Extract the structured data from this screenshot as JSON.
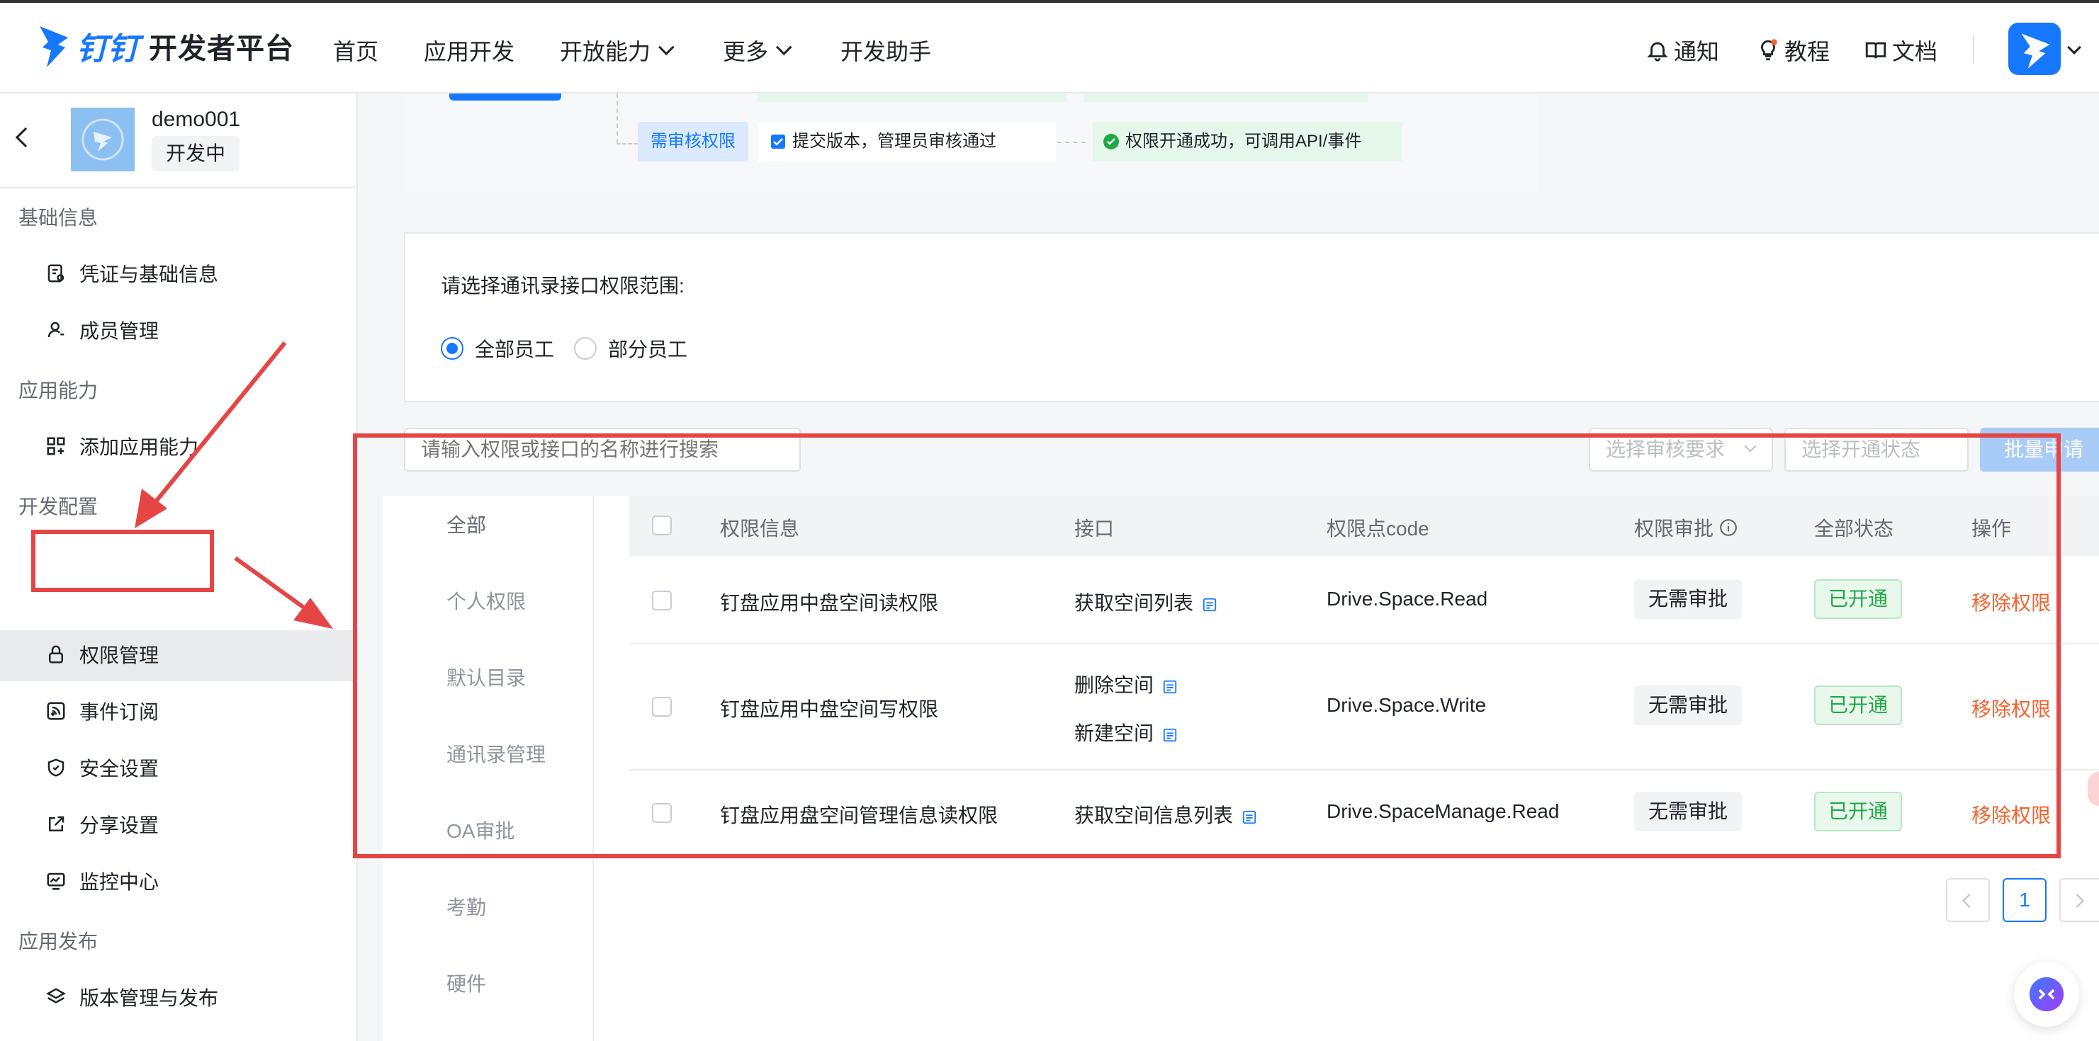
{
  "topbar": {
    "brand_logo_text": "钉钉",
    "brand_title": "开发者平台",
    "nav": [
      "首页",
      "应用开发",
      "开放能力",
      "更多",
      "开发助手"
    ],
    "right": {
      "notify": "通知",
      "tutorial": "教程",
      "docs": "文档"
    }
  },
  "app": {
    "name": "demo001",
    "status": "开发中"
  },
  "sidebar": {
    "groups": [
      {
        "title": "基础信息",
        "items": [
          "凭证与基础信息",
          "成员管理"
        ]
      },
      {
        "title": "应用能力",
        "items": [
          "添加应用能力"
        ]
      },
      {
        "title": "开发配置",
        "items": [
          "权限管理",
          "事件订阅",
          "安全设置",
          "分享设置",
          "监控中心"
        ]
      },
      {
        "title": "应用发布",
        "items": [
          "版本管理与发布"
        ]
      }
    ],
    "active": "权限管理"
  },
  "flow": {
    "tag": "需审核权限",
    "step1": "提交版本，管理员审核通过",
    "step2": "权限开通成功，可调用API/事件"
  },
  "scope": {
    "label": "请选择通讯录接口权限范围:",
    "options": [
      {
        "label": "全部员工",
        "selected": true
      },
      {
        "label": "部分员工",
        "selected": false
      }
    ]
  },
  "filters": {
    "search_placeholder": "请输入权限或接口的名称进行搜索",
    "review_placeholder": "选择审核要求",
    "status_placeholder": "选择开通状态",
    "batch_button": "批量申请"
  },
  "categories": [
    "全部",
    "个人权限",
    "默认目录",
    "通讯录管理",
    "OA审批",
    "考勤",
    "硬件"
  ],
  "table": {
    "headers": [
      "权限信息",
      "接口",
      "权限点code",
      "权限审批",
      "全部状态",
      "操作"
    ],
    "rows": [
      {
        "name": "钉盘应用中盘空间读权限",
        "apis": [
          "获取空间列表"
        ],
        "code": "Drive.Space.Read",
        "approval": "无需审批",
        "status": "已开通",
        "action": "移除权限"
      },
      {
        "name": "钉盘应用中盘空间写权限",
        "apis": [
          "删除空间",
          "新建空间"
        ],
        "code": "Drive.Space.Write",
        "approval": "无需审批",
        "status": "已开通",
        "action": "移除权限"
      },
      {
        "name": "钉盘应用盘空间管理信息读权限",
        "apis": [
          "获取空间信息列表"
        ],
        "code": "Drive.SpaceManage.Read",
        "approval": "无需审批",
        "status": "已开通",
        "action": "移除权限"
      }
    ]
  },
  "pagination": {
    "current": "1"
  },
  "colors": {
    "accent": "#1677ff",
    "annotation": "#e64545",
    "success": "#21a845",
    "danger": "#f5622d"
  }
}
